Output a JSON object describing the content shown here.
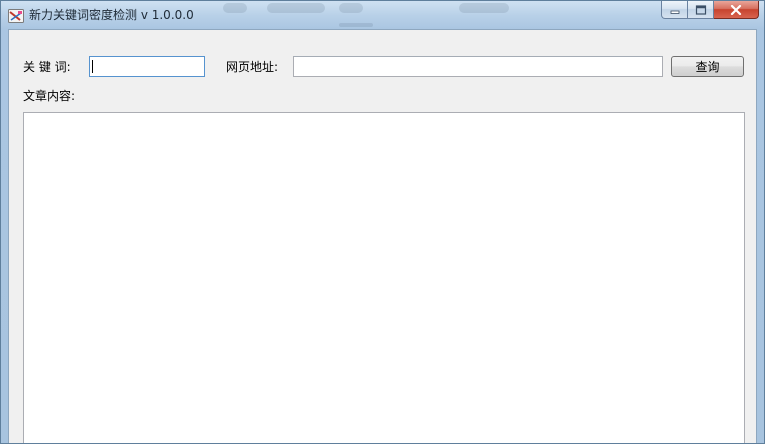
{
  "window": {
    "title": "新力关键词密度检测 v 1.0.0.0"
  },
  "form": {
    "keyword_label": "关 键 词:",
    "keyword_value": "",
    "url_label": "网页地址:",
    "url_value": "",
    "query_button": "查询",
    "content_label": "文章内容:",
    "content_value": ""
  },
  "icons": {
    "app": "app-icon",
    "minimize": "minimize-icon",
    "maximize": "maximize-icon",
    "close": "close-icon"
  },
  "colors": {
    "titlebar": "#b9d1e8",
    "client_bg": "#f0f0f0",
    "close_button": "#c7432f",
    "focus_border": "#5693cf"
  }
}
